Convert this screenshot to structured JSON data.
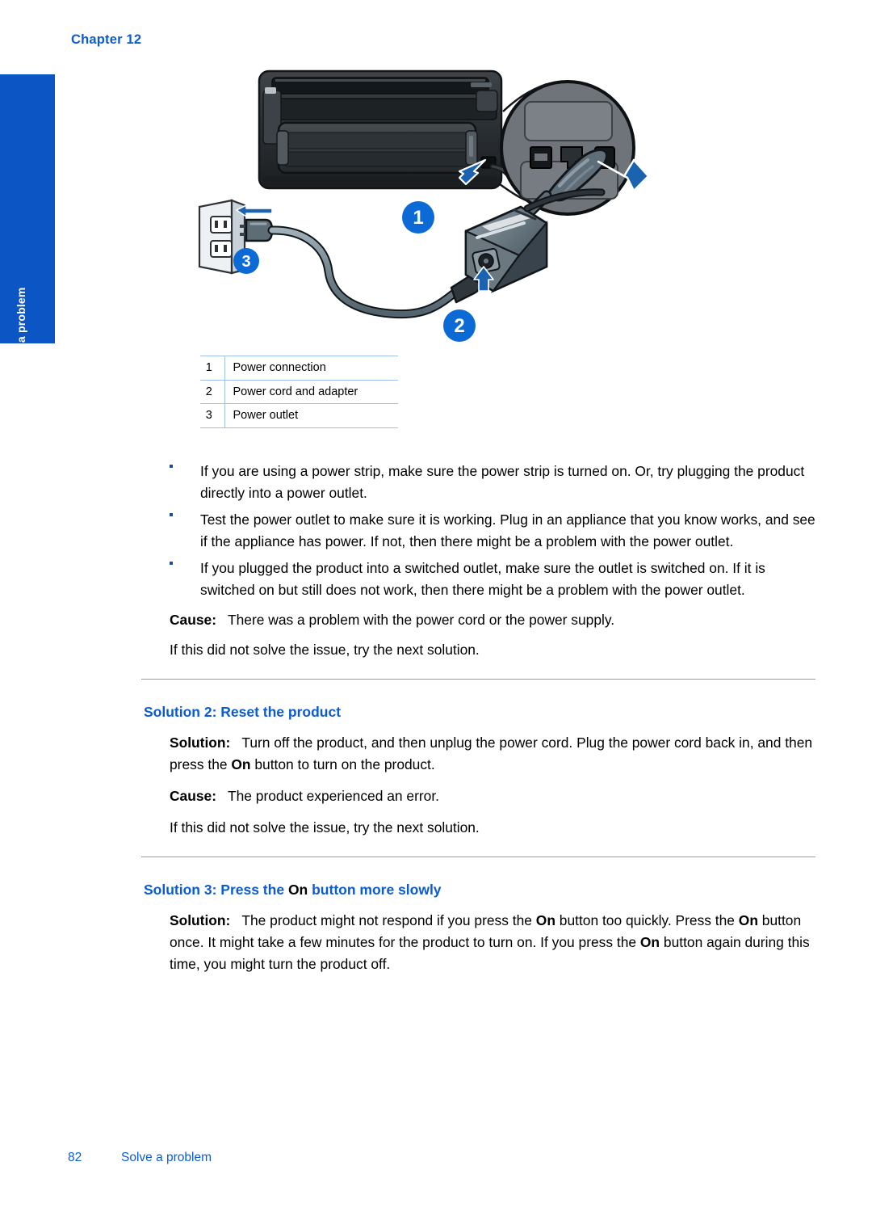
{
  "header": {
    "chapter_label": "Chapter 12"
  },
  "side_tab": {
    "label": "Solve a problem",
    "color": "#0B55C4"
  },
  "illustration": {
    "callouts": [
      {
        "number": "1",
        "position": "printer-power-connection"
      },
      {
        "number": "2",
        "position": "power-cord-and-adapter"
      },
      {
        "number": "3",
        "position": "wall-power-outlet"
      }
    ],
    "callout_color": "#0B6AD6",
    "arrow_color": "#1B63B0"
  },
  "legend": {
    "rows": [
      {
        "num": "1",
        "label": "Power connection"
      },
      {
        "num": "2",
        "label": "Power cord and adapter"
      },
      {
        "num": "3",
        "label": "Power outlet"
      }
    ]
  },
  "bullets": [
    "If you are using a power strip, make sure the power strip is turned on. Or, try plugging the product directly into a power outlet.",
    "Test the power outlet to make sure it is working. Plug in an appliance that you know works, and see if the appliance has power. If not, then there might be a problem with the power outlet.",
    "If you plugged the product into a switched outlet, make sure the outlet is switched on. If it is switched on but still does not work, then there might be a problem with the power outlet."
  ],
  "cause_block_1": {
    "label": "Cause:",
    "text": "There was a problem with the power cord or the power supply.",
    "followup": "If this did not solve the issue, try the next solution."
  },
  "solution_2": {
    "heading": "Solution 2: Reset the product",
    "solution_label": "Solution:",
    "solution_text_part1": "Turn off the product, and then unplug the power cord. Plug the power cord back in, and then press the ",
    "solution_bold_on": "On",
    "solution_text_part2": " button to turn on the product.",
    "cause_label": "Cause:",
    "cause_text": "The product experienced an error.",
    "followup": "If this did not solve the issue, try the next solution."
  },
  "solution_3": {
    "heading_part1": "Solution 3: Press the ",
    "heading_on": "On",
    "heading_part2": " button more slowly",
    "solution_label": "Solution:",
    "text_a": "The product might not respond if you press the ",
    "on_1": "On",
    "text_b": " button too quickly. Press the ",
    "on_2": "On",
    "text_c": " button once. It might take a few minutes for the product to turn on. If you press the ",
    "on_3": "On",
    "text_d": " button again during this time, you might turn the product off."
  },
  "footer": {
    "page_number": "82",
    "title": "Solve a problem"
  },
  "colors": {
    "heading_blue": "#0B5BD3",
    "tab_blue": "#0B55C4",
    "table_border": "#9FC0E8",
    "rule_gray": "#9a9a9a"
  }
}
